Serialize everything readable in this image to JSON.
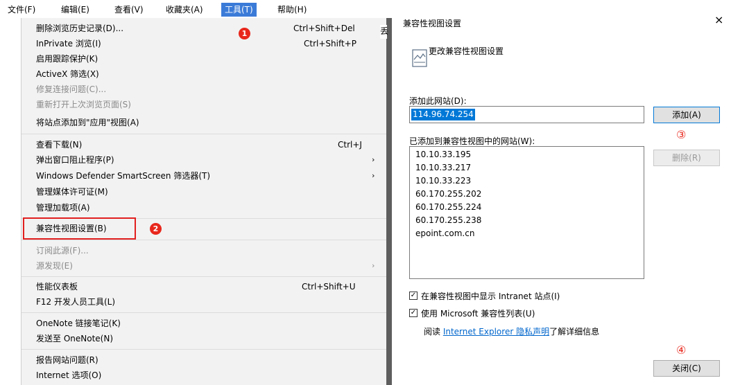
{
  "menubar": {
    "items": [
      "文件(F)",
      "编辑(E)",
      "查看(V)",
      "收藏夹(A)",
      "工具(T)",
      "帮助(H)"
    ]
  },
  "menu": {
    "items": [
      {
        "label": "删除浏览历史记录(D)...",
        "shortcut": "Ctrl+Shift+Del",
        "disabled": false
      },
      {
        "label": "InPrivate 浏览(I)",
        "shortcut": "Ctrl+Shift+P",
        "disabled": false
      },
      {
        "label": "启用跟踪保护(K)",
        "shortcut": "",
        "disabled": false
      },
      {
        "label": "ActiveX 筛选(X)",
        "shortcut": "",
        "disabled": false
      },
      {
        "label": "修复连接问题(C)...",
        "shortcut": "",
        "disabled": true
      },
      {
        "label": "重新打开上次浏览页面(S)",
        "shortcut": "",
        "disabled": true
      },
      {
        "label": "将站点添加到\"应用\"视图(A)",
        "shortcut": "",
        "disabled": false
      },
      {
        "label": "查看下载(N)",
        "shortcut": "Ctrl+J",
        "disabled": false
      },
      {
        "label": "弹出窗口阻止程序(P)",
        "shortcut": "",
        "disabled": false,
        "submenu": true
      },
      {
        "label": "Windows Defender SmartScreen 筛选器(T)",
        "shortcut": "",
        "disabled": false,
        "submenu": true
      },
      {
        "label": "管理媒体许可证(M)",
        "shortcut": "",
        "disabled": false
      },
      {
        "label": "管理加载项(A)",
        "shortcut": "",
        "disabled": false
      },
      {
        "label": "兼容性视图设置(B)",
        "shortcut": "",
        "disabled": false
      },
      {
        "label": "订阅此源(F)...",
        "shortcut": "",
        "disabled": true
      },
      {
        "label": "源发现(E)",
        "shortcut": "",
        "disabled": true,
        "submenu": true
      },
      {
        "label": "性能仪表板",
        "shortcut": "Ctrl+Shift+U",
        "disabled": false
      },
      {
        "label": "F12 开发人员工具(L)",
        "shortcut": "",
        "disabled": false
      },
      {
        "label": "OneNote 链接笔记(K)",
        "shortcut": "",
        "disabled": false
      },
      {
        "label": "发送至 OneNote(N)",
        "shortcut": "",
        "disabled": false
      },
      {
        "label": "报告网站问题(R)",
        "shortcut": "",
        "disabled": false
      },
      {
        "label": "Internet 选项(O)",
        "shortcut": "",
        "disabled": false
      }
    ],
    "strip_char": "丢"
  },
  "annotations": {
    "step1": "1",
    "step2": "2",
    "step3": "③",
    "step4": "④",
    "accent": "#e8271c"
  },
  "dialog": {
    "title": "兼容性视图设置",
    "close_glyph": "×",
    "heading": "更改兼容性视图设置",
    "add_site_label": "添加此网站(D):",
    "add_site_value": "114.96.74.254",
    "add_button": "添加(A)",
    "list_label": "已添加到兼容性视图中的网站(W):",
    "sites": [
      "10.10.33.195",
      "10.10.33.217",
      "10.10.33.223",
      "60.170.255.202",
      "60.170.255.224",
      "60.170.255.238",
      "epoint.com.cn"
    ],
    "remove_button": "删除(R)",
    "intranet_label": "在兼容性视图中显示 Intranet 站点(I)",
    "intranet_checked": true,
    "mslist_label": "使用 Microsoft 兼容性列表(U)",
    "mslist_checked": true,
    "privacy_prefix": "阅读 ",
    "privacy_link": "Internet Explorer 隐私声明",
    "privacy_suffix": "了解详细信息",
    "close_button": "关闭(C)"
  }
}
